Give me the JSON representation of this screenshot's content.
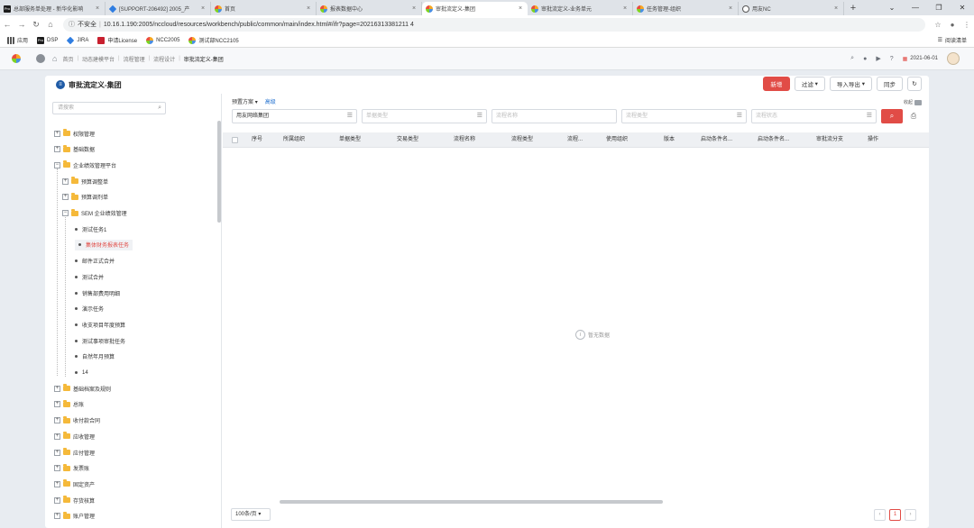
{
  "browser": {
    "tabs": [
      {
        "title": "总部服务单处理 - 新华化影响",
        "favicon": "pro",
        "active": false
      },
      {
        "title": "[SUPPORT-206492] 2005_产",
        "favicon": "diamond",
        "active": false
      },
      {
        "title": "首页",
        "favicon": "yy",
        "active": false
      },
      {
        "title": "报表数据中心",
        "favicon": "yy",
        "active": false
      },
      {
        "title": "审批流定义-集团",
        "favicon": "yy",
        "active": true
      },
      {
        "title": "审批流定义-业务单元",
        "favicon": "yy",
        "active": false
      },
      {
        "title": "任务管理-组织",
        "favicon": "yy",
        "active": false
      },
      {
        "title": "用友NC",
        "favicon": "globe",
        "active": false
      }
    ],
    "new_tab": "+",
    "window_controls": [
      "⌄",
      "—",
      "❐",
      "✕"
    ],
    "url_warning": "不安全",
    "url": "10.16.1.190:2005/nccloud/resources/workbench/public/common/main/index.html#/ifr?page=20216313381211 4",
    "bookmarks": [
      {
        "label": "应用",
        "icon": "apps-icon"
      },
      {
        "label": "DSP",
        "icon": "pro"
      },
      {
        "label": "JIRA",
        "icon": "diamond"
      },
      {
        "label": "申请License",
        "icon": "license"
      },
      {
        "label": "NCC2005",
        "icon": "yy"
      },
      {
        "label": "测试部NCC2105",
        "icon": "yy"
      }
    ],
    "reading_list": "阅读清单"
  },
  "app": {
    "breadcrumb": [
      "首页",
      "动态建模平台",
      "流程管理",
      "流程设计",
      "审批流定义-集团"
    ],
    "date": "2021-06-01"
  },
  "page": {
    "title": "审批流定义-集团",
    "buttons": {
      "add": "新增",
      "filter": "过滤",
      "import_export": "导入导出",
      "sync": "同步",
      "refresh": "↻"
    },
    "tree": {
      "search_placeholder": "请搜索",
      "nodes": [
        {
          "label": "权限管理",
          "level": 0,
          "toggle": "+",
          "type": "folder"
        },
        {
          "label": "基础数据",
          "level": 0,
          "toggle": "+",
          "type": "folder"
        },
        {
          "label": "企业绩效管理平台",
          "level": 0,
          "toggle": "−",
          "type": "folder"
        },
        {
          "label": "预算调整单",
          "level": 1,
          "toggle": "+",
          "type": "folder"
        },
        {
          "label": "预算调剂单",
          "level": 1,
          "toggle": "+",
          "type": "folder"
        },
        {
          "label": "SEM 企业绩效管理",
          "level": 1,
          "toggle": "−",
          "type": "folder"
        },
        {
          "label": "测试任务1",
          "level": 2,
          "type": "leaf"
        },
        {
          "label": "集体财务报表任务",
          "level": 2,
          "type": "leaf",
          "selected": true
        },
        {
          "label": "邮件正式合并",
          "level": 2,
          "type": "leaf"
        },
        {
          "label": "测试合并",
          "level": 2,
          "type": "leaf"
        },
        {
          "label": "销售部费用明细",
          "level": 2,
          "type": "leaf"
        },
        {
          "label": "演示任务",
          "level": 2,
          "type": "leaf"
        },
        {
          "label": "收支项目年度预算",
          "level": 2,
          "type": "leaf"
        },
        {
          "label": "测试事项审批任务",
          "level": 2,
          "type": "leaf"
        },
        {
          "label": "自然年月预算",
          "level": 2,
          "type": "leaf"
        },
        {
          "label": "14",
          "level": 2,
          "type": "leaf"
        },
        {
          "label": "基础档案及规则",
          "level": 0,
          "toggle": "+",
          "type": "folder"
        },
        {
          "label": "总账",
          "level": 0,
          "toggle": "+",
          "type": "folder"
        },
        {
          "label": "收付款合同",
          "level": 0,
          "toggle": "+",
          "type": "folder"
        },
        {
          "label": "应收管理",
          "level": 0,
          "toggle": "+",
          "type": "folder"
        },
        {
          "label": "应付管理",
          "level": 0,
          "toggle": "+",
          "type": "folder"
        },
        {
          "label": "发票账",
          "level": 0,
          "toggle": "+",
          "type": "folder"
        },
        {
          "label": "固定资产",
          "level": 0,
          "toggle": "+",
          "type": "folder"
        },
        {
          "label": "存货核算",
          "level": 0,
          "toggle": "+",
          "type": "folder"
        },
        {
          "label": "账户管理",
          "level": 0,
          "toggle": "+",
          "type": "folder"
        }
      ]
    },
    "query": {
      "scheme_label": "预置方案",
      "advanced_label": "高级",
      "collapse_label": "收起",
      "fields": [
        {
          "value": "用友网络集团",
          "placeholder": ""
        },
        {
          "value": "",
          "placeholder": "单据类型"
        },
        {
          "value": "",
          "placeholder": "流程名称"
        },
        {
          "value": "",
          "placeholder": "流程类型"
        },
        {
          "value": "",
          "placeholder": "流程状态"
        }
      ]
    },
    "table": {
      "columns": [
        "序号",
        "所属组织",
        "单据类型",
        "交易类型",
        "流程名称",
        "流程类型",
        "流程...",
        "使用组织",
        "版本",
        "启动条件名...",
        "启动条件名...",
        "审批流分支",
        "操作"
      ],
      "empty_text": "暂无数据"
    },
    "pagination": {
      "page_size": "100条/页",
      "current_page": "1",
      "prev": "‹",
      "next": "›"
    }
  }
}
